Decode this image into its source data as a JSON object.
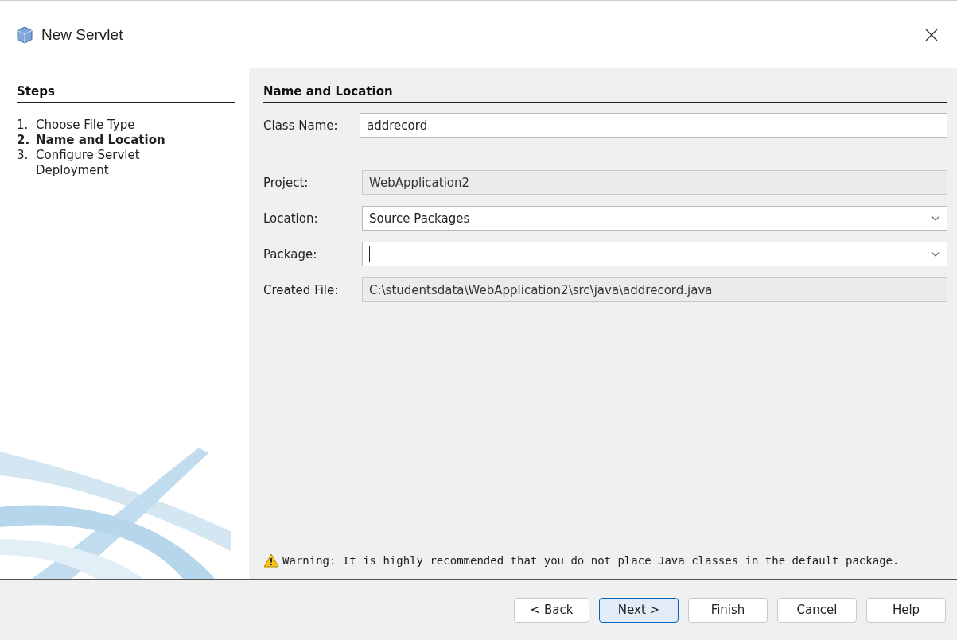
{
  "window": {
    "title": "New Servlet"
  },
  "steps": {
    "heading": "Steps",
    "items": [
      {
        "number": "1.",
        "label": "Choose File Type",
        "selected": false
      },
      {
        "number": "2.",
        "label": "Name and Location",
        "selected": true
      },
      {
        "number": "3.",
        "label": "Configure Servlet Deployment",
        "selected": false
      }
    ]
  },
  "panel": {
    "heading": "Name and Location",
    "class_name": {
      "label": "Class Name:",
      "value": "addrecord"
    },
    "fields": [
      {
        "label": "Project:",
        "kind": "readonly",
        "value": "WebApplication2"
      },
      {
        "label": "Location:",
        "kind": "combo",
        "value": "Source Packages",
        "focused": false
      },
      {
        "label": "Package:",
        "kind": "combo",
        "focused": true
      },
      {
        "label": "Created File:",
        "kind": "readonly",
        "value": "C:\\studentsdata\\WebApplication2\\src\\java\\addrecord.java"
      }
    ],
    "warning": "Warning: It is highly recommended that you do not place Java classes in the default package."
  },
  "buttons": [
    {
      "label": "< Back",
      "default": false
    },
    {
      "label": "Next >",
      "default": true
    },
    {
      "label": "Finish",
      "default": false
    },
    {
      "label": "Cancel",
      "default": false
    },
    {
      "label": "Help",
      "default": false
    }
  ]
}
